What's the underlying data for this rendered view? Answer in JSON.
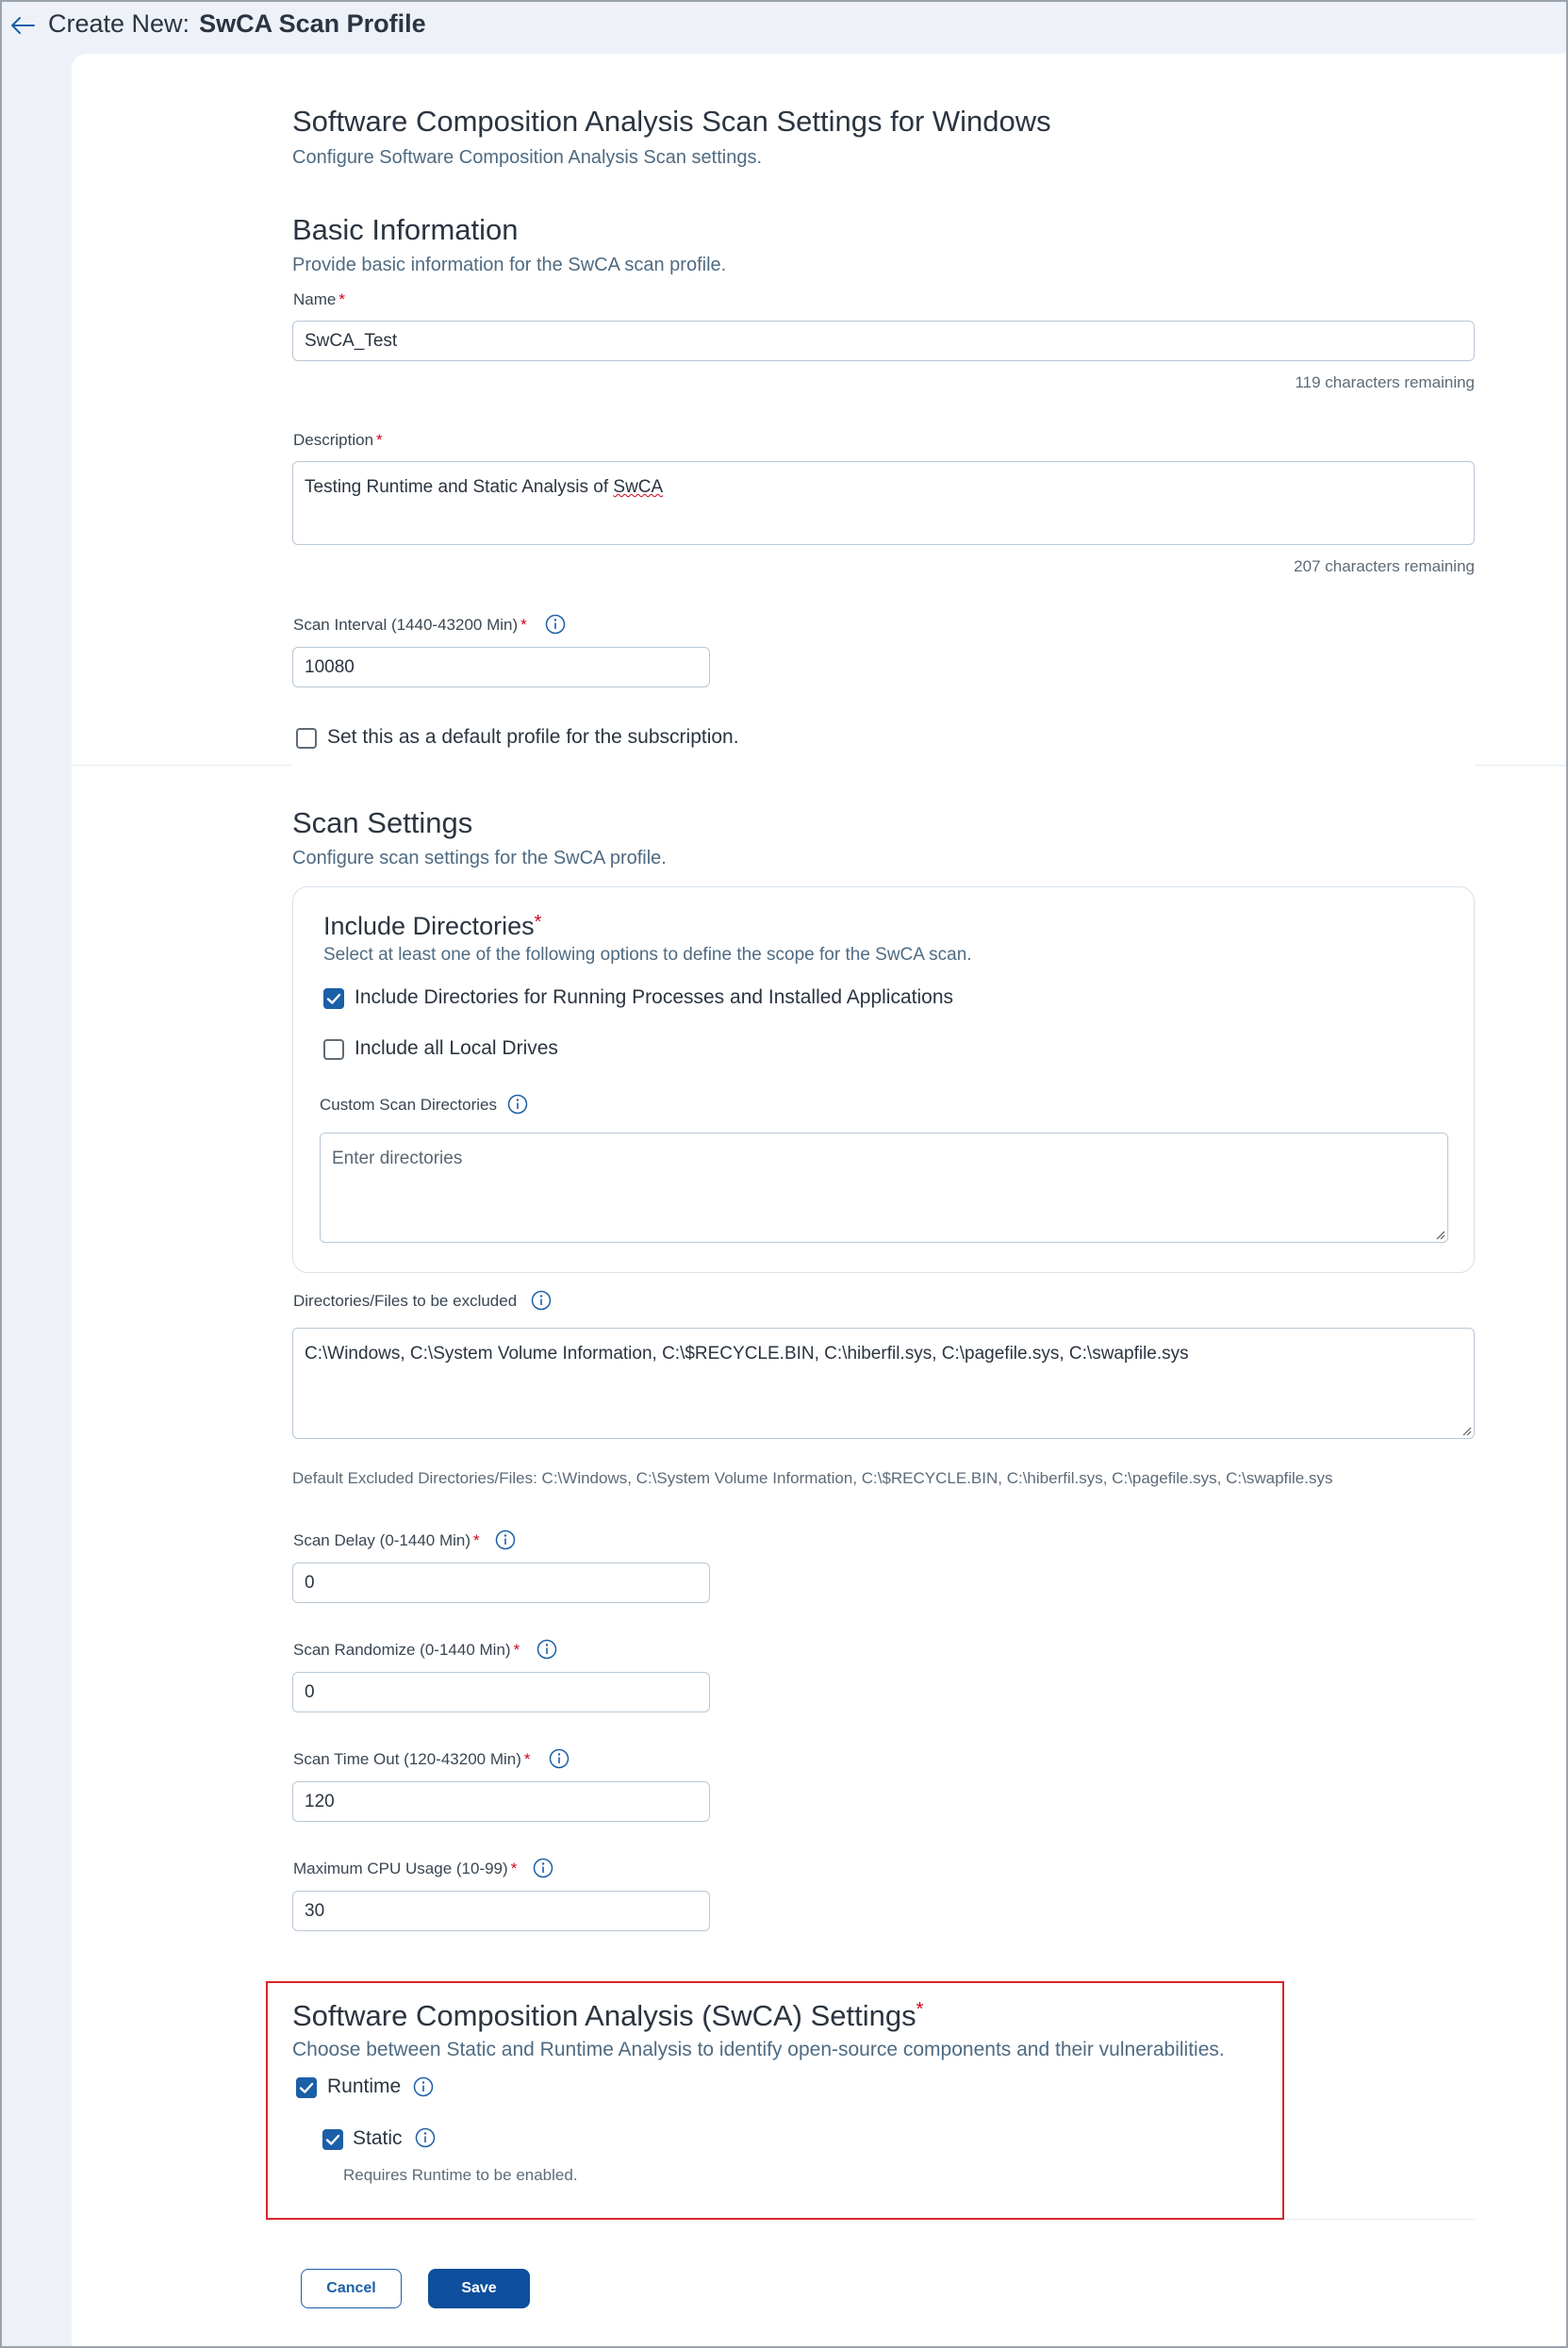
{
  "header": {
    "prefix": "Create New:",
    "title": "SwCA Scan Profile"
  },
  "page": {
    "title": "Software Composition Analysis Scan Settings for Windows",
    "subtitle": "Configure Software Composition Analysis Scan settings."
  },
  "basic_info": {
    "title": "Basic Information",
    "subtitle": "Provide basic information for the SwCA scan profile.",
    "name_label": "Name",
    "name_value": "SwCA_Test",
    "name_remaining": "119 characters remaining",
    "description_label": "Description",
    "description_value_prefix": "Testing Runtime and Static Analysis of ",
    "description_value_flagged": "SwCA",
    "description_remaining": "207 characters remaining",
    "interval_label": "Scan Interval (1440-43200 Min)",
    "interval_value": "10080",
    "default_profile_label": "Set this as a default profile for the subscription.",
    "default_profile_checked": false
  },
  "scan_settings": {
    "title": "Scan Settings",
    "subtitle": "Configure scan settings for the SwCA profile.",
    "include_dirs": {
      "title": "Include Directories",
      "subtitle": "Select at least one of the following options to define the scope for the SwCA scan.",
      "running_processes_label": "Include Directories for Running Processes and Installed Applications",
      "running_processes_checked": true,
      "local_drives_label": "Include all Local Drives",
      "local_drives_checked": false,
      "custom_label": "Custom Scan Directories",
      "custom_placeholder": "Enter directories"
    },
    "excluded_label": "Directories/Files to be excluded",
    "excluded_value": "C:\\Windows, C:\\System Volume Information, C:\\$RECYCLE.BIN, C:\\hiberfil.sys, C:\\pagefile.sys, C:\\swapfile.sys",
    "default_excluded_note": "Default Excluded Directories/Files: C:\\Windows, C:\\System Volume Information, C:\\$RECYCLE.BIN, C:\\hiberfil.sys, C:\\pagefile.sys, C:\\swapfile.sys",
    "scan_delay_label": "Scan Delay (0-1440 Min)",
    "scan_delay_value": "0",
    "scan_randomize_label": "Scan Randomize (0-1440 Min)",
    "scan_randomize_value": "0",
    "scan_timeout_label": "Scan Time Out (120-43200 Min)",
    "scan_timeout_value": "120",
    "cpu_label": "Maximum CPU Usage (10-99)",
    "cpu_value": "30"
  },
  "swca_settings": {
    "title": "Software Composition Analysis (SwCA) Settings",
    "subtitle": "Choose between Static and Runtime Analysis to identify open-source components and their vulnerabilities.",
    "runtime_label": "Runtime",
    "runtime_checked": true,
    "static_label": "Static",
    "static_checked": true,
    "static_note": "Requires Runtime to be enabled."
  },
  "actions": {
    "cancel_label": "Cancel",
    "save_label": "Save"
  },
  "required_marker": "*",
  "colors": {
    "accent": "#1b5fa8",
    "save_button": "#0d4f9c",
    "required": "#d0021b",
    "highlight_border": "#d9252a"
  }
}
